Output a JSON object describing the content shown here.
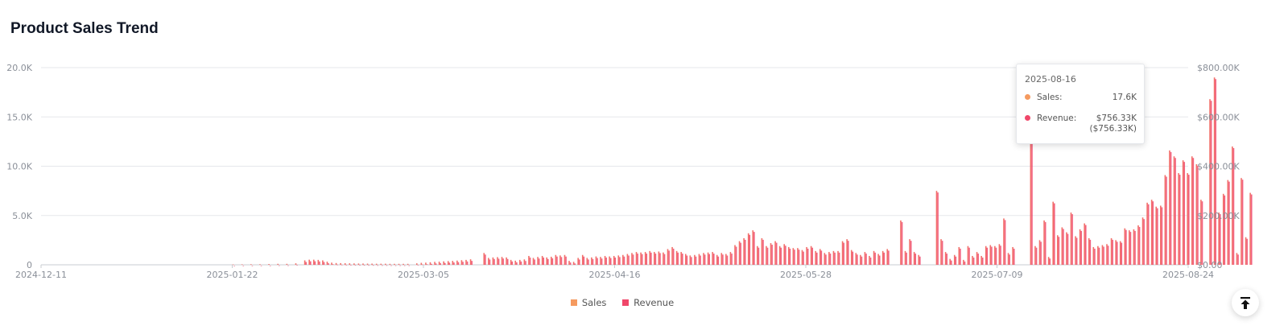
{
  "header": {
    "title": "Product Sales Trend"
  },
  "colors": {
    "sales": "#f59a5f",
    "revenue": "#f0476a",
    "bar": "#f2706a",
    "grid": "#e5e7eb"
  },
  "chart_data": {
    "type": "bar",
    "title": "Product Sales Trend",
    "x_ticks": [
      "2024-12-11",
      "2025-01-22",
      "2025-03-05",
      "2025-04-16",
      "2025-05-28",
      "2025-07-09",
      "2025-08-24"
    ],
    "y_left_ticks": [
      "0",
      "5.0K",
      "10.0K",
      "15.0K",
      "20.0K"
    ],
    "y_right_ticks": [
      "$0.00",
      "$200.00K",
      "$400.00K",
      "$600.00K",
      "$800.00K"
    ],
    "ylim_sales": [
      0,
      20000
    ],
    "ylim_revenue": [
      0,
      800000
    ],
    "x_range": [
      "2024-12-11",
      "2025-08-24"
    ],
    "grid": true,
    "legend_position": "bottom-center",
    "series": [
      {
        "name": "Sales",
        "color": "#f59a5f",
        "points": [
          [
            "2025-01-23",
            40
          ],
          [
            "2025-01-25",
            50
          ],
          [
            "2025-01-27",
            60
          ],
          [
            "2025-01-29",
            60
          ],
          [
            "2025-01-31",
            80
          ],
          [
            "2025-02-02",
            100
          ],
          [
            "2025-02-04",
            100
          ],
          [
            "2025-02-06",
            150
          ],
          [
            "2025-02-08",
            450
          ],
          [
            "2025-02-09",
            520
          ],
          [
            "2025-02-10",
            520
          ],
          [
            "2025-02-11",
            500
          ],
          [
            "2025-02-12",
            450
          ],
          [
            "2025-02-13",
            320
          ],
          [
            "2025-02-14",
            220
          ],
          [
            "2025-02-15",
            180
          ],
          [
            "2025-02-16",
            170
          ],
          [
            "2025-02-17",
            160
          ],
          [
            "2025-02-18",
            150
          ],
          [
            "2025-02-19",
            140
          ],
          [
            "2025-02-20",
            130
          ],
          [
            "2025-02-21",
            130
          ],
          [
            "2025-02-22",
            120
          ],
          [
            "2025-02-23",
            120
          ],
          [
            "2025-02-24",
            110
          ],
          [
            "2025-02-25",
            110
          ],
          [
            "2025-02-26",
            110
          ],
          [
            "2025-02-27",
            100
          ],
          [
            "2025-02-28",
            100
          ],
          [
            "2025-03-01",
            100
          ],
          [
            "2025-03-02",
            100
          ],
          [
            "2025-03-03",
            100
          ],
          [
            "2025-03-05",
            150
          ],
          [
            "2025-03-06",
            200
          ],
          [
            "2025-03-07",
            220
          ],
          [
            "2025-03-08",
            260
          ],
          [
            "2025-03-09",
            300
          ],
          [
            "2025-03-10",
            320
          ],
          [
            "2025-03-11",
            350
          ],
          [
            "2025-03-12",
            380
          ],
          [
            "2025-03-13",
            400
          ],
          [
            "2025-03-14",
            430
          ],
          [
            "2025-03-15",
            470
          ],
          [
            "2025-03-16",
            500
          ],
          [
            "2025-03-17",
            560
          ],
          [
            "2025-03-20",
            1200
          ],
          [
            "2025-03-21",
            700
          ],
          [
            "2025-03-22",
            750
          ],
          [
            "2025-03-23",
            780
          ],
          [
            "2025-03-24",
            800
          ],
          [
            "2025-03-25",
            750
          ],
          [
            "2025-03-26",
            500
          ],
          [
            "2025-03-27",
            420
          ],
          [
            "2025-03-28",
            500
          ],
          [
            "2025-03-29",
            550
          ],
          [
            "2025-03-30",
            900
          ],
          [
            "2025-03-31",
            700
          ],
          [
            "2025-04-01",
            800
          ],
          [
            "2025-04-02",
            900
          ],
          [
            "2025-04-03",
            750
          ],
          [
            "2025-04-04",
            820
          ],
          [
            "2025-04-05",
            1000
          ],
          [
            "2025-04-06",
            950
          ],
          [
            "2025-04-07",
            1000
          ],
          [
            "2025-04-08",
            400
          ],
          [
            "2025-04-09",
            300
          ],
          [
            "2025-04-10",
            700
          ],
          [
            "2025-04-11",
            1000
          ],
          [
            "2025-04-12",
            700
          ],
          [
            "2025-04-13",
            750
          ],
          [
            "2025-04-14",
            850
          ],
          [
            "2025-04-15",
            800
          ],
          [
            "2025-04-16",
            900
          ],
          [
            "2025-04-17",
            850
          ],
          [
            "2025-04-18",
            900
          ],
          [
            "2025-04-19",
            950
          ],
          [
            "2025-04-20",
            1000
          ],
          [
            "2025-04-21",
            1100
          ],
          [
            "2025-04-22",
            1200
          ],
          [
            "2025-04-23",
            1300
          ],
          [
            "2025-04-24",
            1250
          ],
          [
            "2025-04-25",
            1300
          ],
          [
            "2025-04-26",
            1400
          ],
          [
            "2025-04-27",
            1300
          ],
          [
            "2025-04-28",
            1350
          ],
          [
            "2025-04-29",
            1250
          ],
          [
            "2025-04-30",
            1600
          ],
          [
            "2025-05-01",
            1800
          ],
          [
            "2025-05-02",
            1400
          ],
          [
            "2025-05-03",
            1300
          ],
          [
            "2025-05-04",
            1100
          ],
          [
            "2025-05-05",
            950
          ],
          [
            "2025-05-06",
            1000
          ],
          [
            "2025-05-07",
            1100
          ],
          [
            "2025-05-08",
            1200
          ],
          [
            "2025-05-09",
            1250
          ],
          [
            "2025-05-10",
            1300
          ],
          [
            "2025-05-11",
            1000
          ],
          [
            "2025-05-12",
            1200
          ],
          [
            "2025-05-13",
            1100
          ],
          [
            "2025-05-14",
            1300
          ],
          [
            "2025-05-15",
            2000
          ],
          [
            "2025-05-16",
            2400
          ],
          [
            "2025-05-17",
            2700
          ],
          [
            "2025-05-18",
            3200
          ],
          [
            "2025-05-19",
            3500
          ],
          [
            "2025-05-20",
            1900
          ],
          [
            "2025-05-21",
            2700
          ],
          [
            "2025-05-22",
            1900
          ],
          [
            "2025-05-23",
            2200
          ],
          [
            "2025-05-24",
            2400
          ],
          [
            "2025-05-25",
            1900
          ],
          [
            "2025-05-26",
            2100
          ],
          [
            "2025-05-27",
            1800
          ],
          [
            "2025-05-28",
            1700
          ],
          [
            "2025-05-29",
            1700
          ],
          [
            "2025-05-30",
            1500
          ],
          [
            "2025-05-31",
            1800
          ],
          [
            "2025-06-01",
            1900
          ],
          [
            "2025-06-02",
            1400
          ],
          [
            "2025-06-03",
            1600
          ],
          [
            "2025-06-04",
            1200
          ],
          [
            "2025-06-05",
            1300
          ],
          [
            "2025-06-06",
            1400
          ],
          [
            "2025-06-07",
            1400
          ],
          [
            "2025-06-08",
            2400
          ],
          [
            "2025-06-09",
            2600
          ],
          [
            "2025-06-10",
            1500
          ],
          [
            "2025-06-11",
            1200
          ],
          [
            "2025-06-12",
            1000
          ],
          [
            "2025-06-13",
            1300
          ],
          [
            "2025-06-14",
            900
          ],
          [
            "2025-06-15",
            1400
          ],
          [
            "2025-06-16",
            1100
          ],
          [
            "2025-06-17",
            1400
          ],
          [
            "2025-06-18",
            1600
          ],
          [
            "2025-06-21",
            4500
          ],
          [
            "2025-06-22",
            1400
          ],
          [
            "2025-06-23",
            2600
          ],
          [
            "2025-06-24",
            1300
          ],
          [
            "2025-06-25",
            1000
          ],
          [
            "2025-06-29",
            7500
          ],
          [
            "2025-06-30",
            2600
          ],
          [
            "2025-07-01",
            1300
          ],
          [
            "2025-07-02",
            600
          ],
          [
            "2025-07-03",
            1000
          ],
          [
            "2025-07-04",
            1800
          ],
          [
            "2025-07-05",
            500
          ],
          [
            "2025-07-06",
            1900
          ],
          [
            "2025-07-07",
            900
          ],
          [
            "2025-07-08",
            1300
          ],
          [
            "2025-07-09",
            900
          ],
          [
            "2025-07-10",
            1900
          ],
          [
            "2025-07-11",
            2000
          ],
          [
            "2025-07-12",
            1900
          ],
          [
            "2025-07-13",
            2100
          ],
          [
            "2025-07-14",
            4700
          ],
          [
            "2025-07-15",
            1200
          ],
          [
            "2025-07-16",
            1800
          ],
          [
            "2025-07-20",
            15700
          ],
          [
            "2025-07-21",
            1900
          ],
          [
            "2025-07-22",
            2500
          ],
          [
            "2025-07-23",
            4500
          ],
          [
            "2025-07-24",
            800
          ],
          [
            "2025-07-25",
            6400
          ],
          [
            "2025-07-26",
            3000
          ],
          [
            "2025-07-27",
            3800
          ],
          [
            "2025-07-28",
            3300
          ],
          [
            "2025-07-29",
            5300
          ],
          [
            "2025-07-30",
            2900
          ],
          [
            "2025-07-31",
            3600
          ],
          [
            "2025-08-01",
            4200
          ],
          [
            "2025-08-02",
            2700
          ],
          [
            "2025-08-03",
            1800
          ],
          [
            "2025-08-04",
            1900
          ],
          [
            "2025-08-05",
            2000
          ],
          [
            "2025-08-06",
            2100
          ],
          [
            "2025-08-07",
            2700
          ],
          [
            "2025-08-08",
            2500
          ],
          [
            "2025-08-09",
            2400
          ],
          [
            "2025-08-10",
            3700
          ],
          [
            "2025-08-11",
            3500
          ],
          [
            "2025-08-12",
            3600
          ],
          [
            "2025-08-13",
            4000
          ],
          [
            "2025-08-14",
            4800
          ],
          [
            "2025-08-15",
            6300
          ],
          [
            "2025-08-16",
            6600
          ],
          [
            "2025-08-17",
            5900
          ],
          [
            "2025-08-18",
            6000
          ],
          [
            "2025-08-19",
            9100
          ],
          [
            "2025-08-20",
            11600
          ],
          [
            "2025-08-21",
            11000
          ],
          [
            "2025-08-22",
            9300
          ],
          [
            "2025-08-23",
            10600
          ],
          [
            "2025-08-24",
            9300
          ],
          [
            "2025-08-25",
            11000
          ],
          [
            "2025-08-26",
            10200
          ],
          [
            "2025-08-27",
            6600
          ],
          [
            "2025-08-29",
            16800
          ],
          [
            "2025-08-30",
            19000
          ],
          [
            "2025-08-31",
            5300
          ],
          [
            "2025-09-01",
            7200
          ],
          [
            "2025-09-02",
            8600
          ],
          [
            "2025-09-03",
            12000
          ],
          [
            "2025-09-04",
            1200
          ],
          [
            "2025-09-05",
            8800
          ],
          [
            "2025-09-06",
            2800
          ],
          [
            "2025-09-07",
            7300
          ]
        ]
      },
      {
        "name": "Revenue",
        "color": "#f0476a",
        "mirrors": "Sales"
      }
    ],
    "tooltip": {
      "date": "2025-08-16",
      "sales_label": "Sales:",
      "sales_value": "17.6K",
      "revenue_label": "Revenue:",
      "revenue_value": "$756.33K",
      "revenue_value_2": "($756.33K)"
    },
    "legend": [
      {
        "label": "Sales",
        "color": "#f59a5f"
      },
      {
        "label": "Revenue",
        "color": "#f0476a"
      }
    ]
  },
  "controls": {
    "back_to_top_icon": "arrow-up-to-line-icon"
  }
}
